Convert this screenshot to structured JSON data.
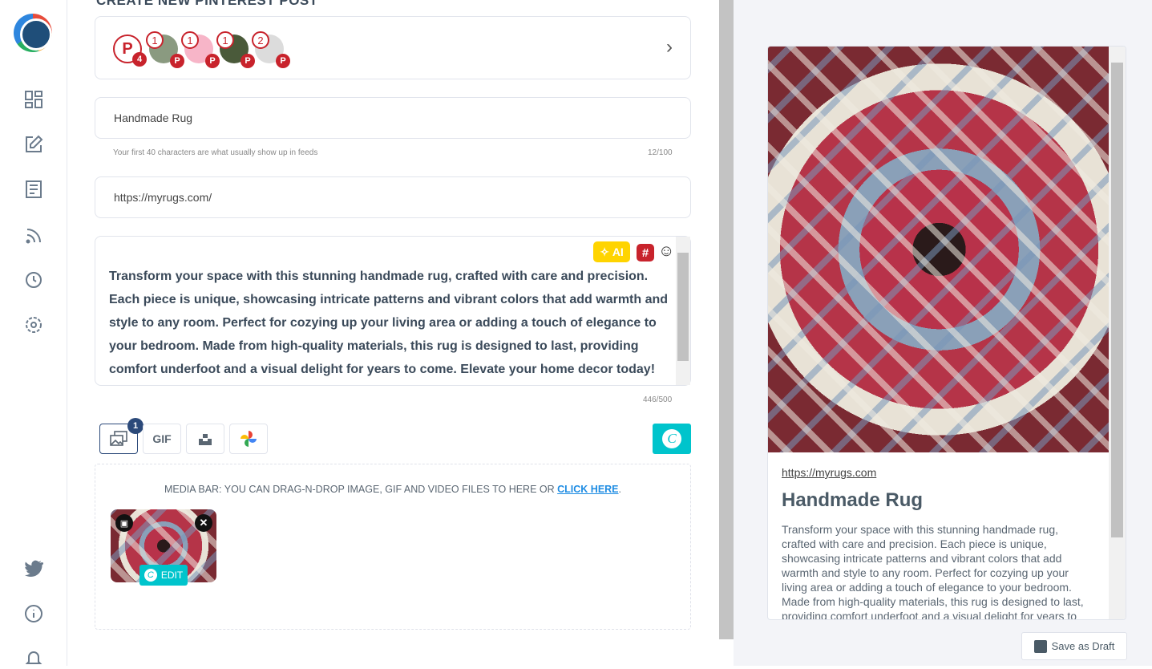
{
  "page_title": "CREATE NEW PINTEREST POST",
  "accounts": [
    {
      "count": "4",
      "type": "pinterest-all"
    },
    {
      "count": "1",
      "color": "#8a9a80"
    },
    {
      "count": "1",
      "color": "#f7b5c8"
    },
    {
      "count": "1",
      "color": "#4a5a3a"
    },
    {
      "count": "2",
      "color": "#dcdcdc"
    }
  ],
  "pin_glyph": "P",
  "post_title": "Handmade Rug",
  "title_hint": "Your first 40 characters are what usually show up in feeds",
  "title_count": "12/100",
  "link": "https://myrugs.com/",
  "ai_label": "AI",
  "description": "Transform your space with this stunning handmade rug, crafted with care and precision. Each piece is unique, showcasing intricate patterns and vibrant colors that add warmth and style to any room. Perfect for cozying up your living area or adding a touch of elegance to your bedroom. Made from high-quality materials, this rug is designed to last, providing comfort underfoot and a visual delight for years to come. Elevate your home decor today!",
  "desc_count": "446/500",
  "toolbar": {
    "media_badge": "1",
    "gif": "GIF",
    "canva": "C"
  },
  "media_bar": {
    "text": "MEDIA BAR: YOU CAN DRAG-N-DROP IMAGE, GIF AND VIDEO FILES TO HERE OR ",
    "link": "CLICK HERE",
    "edit": "EDIT"
  },
  "preview": {
    "url": "https://myrugs.com",
    "title": "Handmade Rug",
    "description": "Transform your space with this stunning handmade rug, crafted with care and precision. Each piece is unique, showcasing intricate patterns and vibrant colors that add warmth and style to any room. Perfect for cozying up your living area or adding a touch of elegance to your bedroom. Made from high-quality materials, this rug is designed to last, providing comfort underfoot and a visual delight for years to come."
  },
  "save_draft": "Save as Draft",
  "colors": {
    "pinterest": "#c8232c",
    "teal": "#00c4cc",
    "ai": "#ffd400"
  }
}
